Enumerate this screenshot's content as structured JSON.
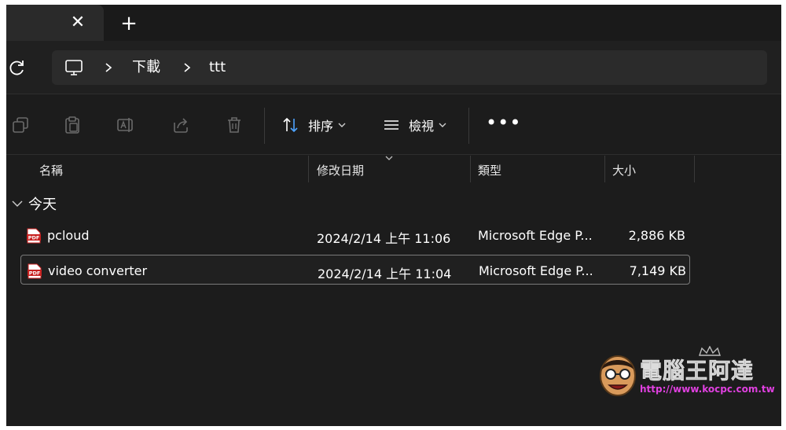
{
  "tabs": {
    "close_glyph": "✕",
    "new_tab_glyph": "+"
  },
  "address": {
    "icons": [
      "refresh-icon",
      "this-pc-icon"
    ],
    "crumbs": [
      {
        "label": "下載"
      },
      {
        "label": "ttt"
      }
    ]
  },
  "toolbar": {
    "icons": [
      "copy-icon",
      "paste-icon",
      "rename-icon",
      "share-icon",
      "delete-icon"
    ],
    "sort_label": "排序",
    "view_label": "檢視",
    "more_glyph": "•••"
  },
  "columns": {
    "name": "名稱",
    "modified": "修改日期",
    "type": "類型",
    "size": "大小"
  },
  "group": {
    "label": "今天"
  },
  "files": [
    {
      "name": "pcloud",
      "modified": "2024/2/14 上午 11:06",
      "type": "Microsoft Edge P...",
      "size": "2,886 KB",
      "icon": "pdf-icon",
      "selected": false
    },
    {
      "name": "video converter",
      "modified": "2024/2/14 上午 11:04",
      "type": "Microsoft Edge P...",
      "size": "7,149 KB",
      "icon": "pdf-icon",
      "selected": true
    }
  ],
  "watermark": {
    "title": "電腦王阿達",
    "url": "http://www.kocpc.com.tw"
  },
  "colors": {
    "background": "#1c1c1c",
    "address_bar": "#2b2b2b",
    "pdf_red": "#c8201f",
    "watermark_url": "#e040e0"
  }
}
